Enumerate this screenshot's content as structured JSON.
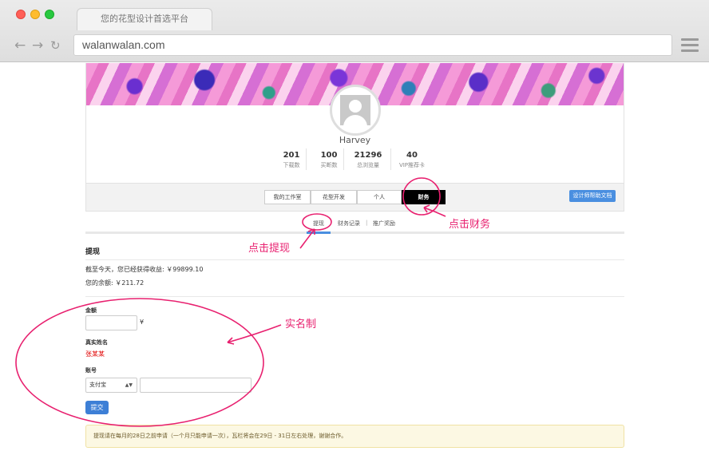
{
  "browser": {
    "tab_title": "您的花型设计首选平台",
    "url": "walanwalan.com",
    "icons": {
      "back": "←",
      "forward": "→",
      "reload": "↻"
    }
  },
  "profile": {
    "username": "Harvey",
    "stats": [
      {
        "value": "201",
        "label": "下载数"
      },
      {
        "value": "100",
        "label": "买断数"
      },
      {
        "value": "21296",
        "label": "总浏览量"
      },
      {
        "value": "40",
        "label": "VIP推荐卡"
      }
    ]
  },
  "main_tabs": [
    {
      "label": "我的工作室"
    },
    {
      "label": "花型开发"
    },
    {
      "label": "个人"
    },
    {
      "label": "财务",
      "active": true
    }
  ],
  "help_button": "设计师帮助文档",
  "sub_tabs": [
    {
      "label": "提现",
      "active": true
    },
    {
      "label": "财务记录"
    },
    {
      "label": "|"
    },
    {
      "label": "推广奖励"
    }
  ],
  "withdraw": {
    "title": "提现",
    "earnings_text": "截至今天，您已经获得收益: ￥99899.10",
    "balance_text": "您的余额: ￥211.72",
    "amount_label": "金额",
    "amount_value": "",
    "currency_symbol": "¥",
    "realname_label": "真实姓名",
    "realname_value": "张某某",
    "account_label": "账号",
    "account_type_selected": "支付宝",
    "account_value": "",
    "submit_label": "提交"
  },
  "notice": "提现请在每月的28日之前申请（一个月只能申请一次），瓦栏将会在29日 - 31日左右处理，谢谢合作。",
  "annotations": {
    "click_finance": "点击财务",
    "click_withdraw": "点击提现",
    "real_name": "实名制",
    "color": "#e8206f"
  }
}
